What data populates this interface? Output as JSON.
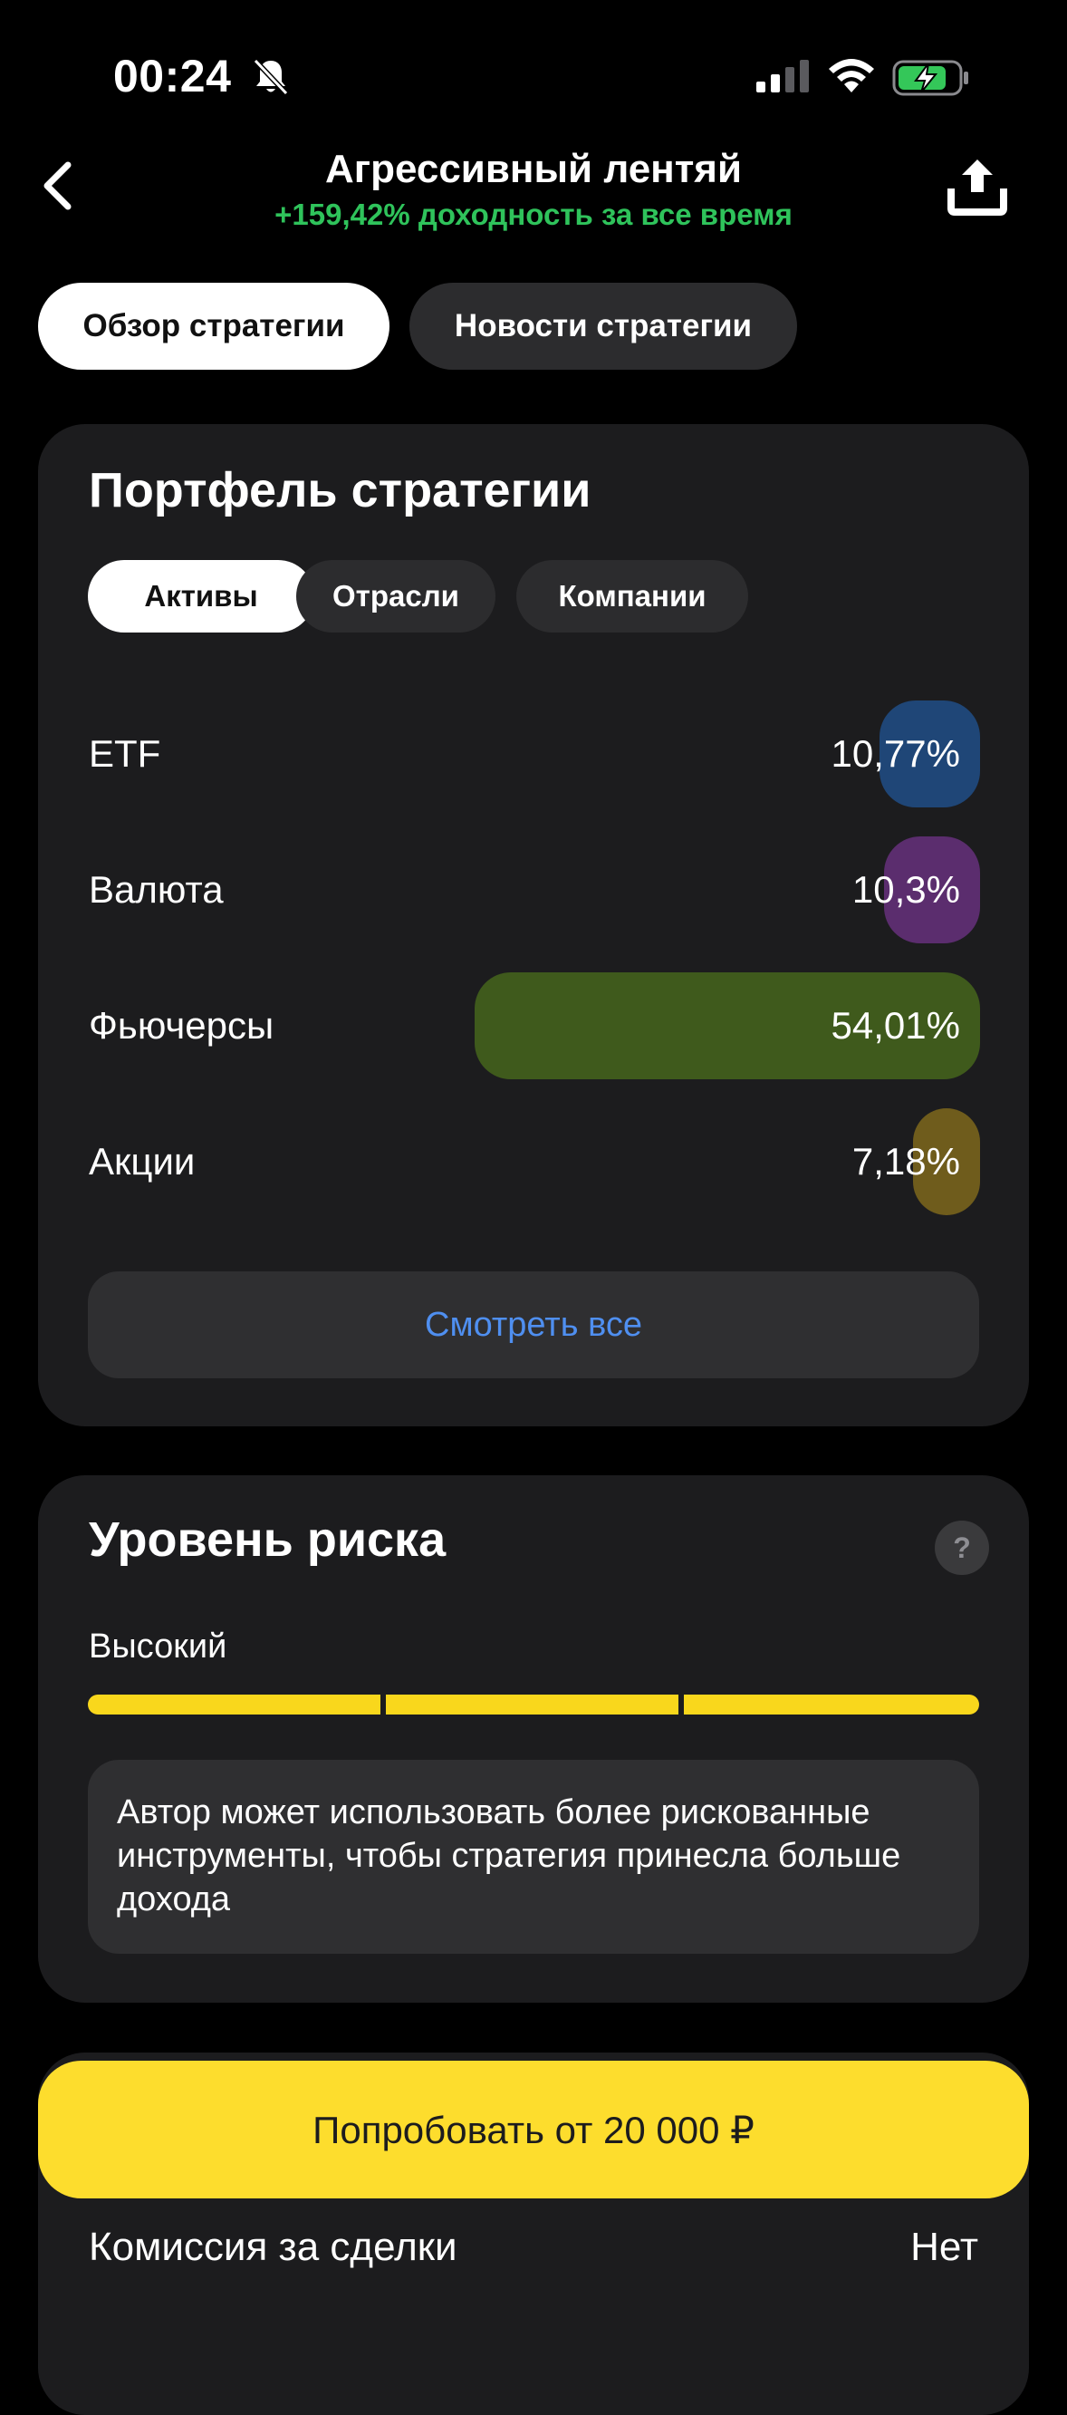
{
  "status_bar": {
    "time": "00:24"
  },
  "header": {
    "title": "Агрессивный лентяй",
    "subtitle": "+159,42% доходность за все время"
  },
  "tabs": [
    {
      "label": "Обзор стратегии",
      "active": true
    },
    {
      "label": "Новости стратегии",
      "active": false
    }
  ],
  "portfolio": {
    "title": "Портфель стратегии",
    "subtabs": [
      {
        "label": "Активы",
        "active": true
      },
      {
        "label": "Отрасли",
        "active": false
      },
      {
        "label": "Компании",
        "active": false
      }
    ],
    "assets": [
      {
        "label": "ETF",
        "value": "10,77%",
        "share": 10.77,
        "color": "#1f4677"
      },
      {
        "label": "Валюта",
        "value": "10,3%",
        "share": 10.3,
        "color": "#5b2d6e"
      },
      {
        "label": "Фьючерсы",
        "value": "54,01%",
        "share": 54.01,
        "color": "#3f5a1c"
      },
      {
        "label": "Акции",
        "value": "7,18%",
        "share": 7.18,
        "color": "#6f5c1c"
      }
    ],
    "see_all_label": "Смотреть все"
  },
  "risk": {
    "title": "Уровень риска",
    "help_label": "?",
    "level_label": "Высокий",
    "level_filled": 3,
    "level_total": 3,
    "color": "#f9d71c",
    "description": "Автор может использовать более рискованные инструменты, чтобы стратегия принесла больше дохода"
  },
  "cta": {
    "label": "Попробовать от 20 000 ₽",
    "color": "#fddd2d"
  },
  "commission": {
    "label": "Комиссия за сделки",
    "value": "Нет"
  },
  "colors": {
    "accent_green": "#2fc35b",
    "link_blue": "#4f8ff0",
    "card_bg": "#1c1c1e"
  }
}
